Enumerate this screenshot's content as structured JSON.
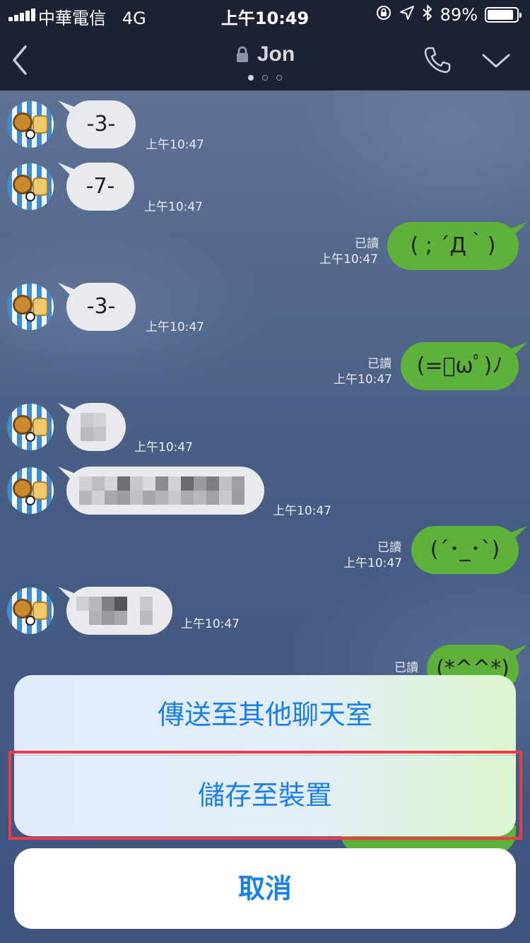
{
  "status_bar": {
    "carrier": "中華電信",
    "network": "4G",
    "time": "上午10:49",
    "battery_pct": "89%",
    "battery_level": 0.89,
    "icons": [
      "orientation-lock-icon",
      "location-arrow-icon",
      "bluetooth-icon"
    ]
  },
  "header": {
    "title": "Jon",
    "page_dots": 3,
    "active_dot": 0,
    "icons": [
      "back-chevron-icon",
      "lock-icon",
      "phone-icon",
      "chevron-down-icon"
    ]
  },
  "messages": [
    {
      "dir": "in",
      "text": "-3-",
      "time": "上午10:47"
    },
    {
      "dir": "in",
      "text": "-7-",
      "time": "上午10:47"
    },
    {
      "dir": "out",
      "text": "( ; ´Д｀)",
      "time": "上午10:47",
      "status": "已讀"
    },
    {
      "dir": "in",
      "text": "-3-",
      "time": "上午10:47"
    },
    {
      "dir": "out",
      "text": "(=ﾟωﾟ)ﾉ",
      "time": "上午10:47",
      "status": "已讀"
    },
    {
      "dir": "in",
      "text": "",
      "time": "上午10:47",
      "pixelated": true
    },
    {
      "dir": "in",
      "text": "",
      "time": "上午10:47",
      "pixelated": true
    },
    {
      "dir": "out",
      "text": "(´･_･`)",
      "time": "上午10:47",
      "status": "已讀"
    },
    {
      "dir": "in",
      "text": "",
      "time": "上午10:47",
      "pixelated": true
    },
    {
      "dir": "out",
      "text": "(*^^*)",
      "time": "",
      "status": "已讀"
    }
  ],
  "action_sheet": {
    "send_to_other_chats": "傳送至其他聊天室",
    "save_to_device": "儲存至裝置",
    "cancel": "取消"
  },
  "colors": {
    "accent": "#1a7fe8",
    "outgoing_bubble": "#5eb139",
    "incoming_bubble": "#e9eaee",
    "highlight_border": "#ef3b48",
    "header_bg": "#1c2233"
  }
}
